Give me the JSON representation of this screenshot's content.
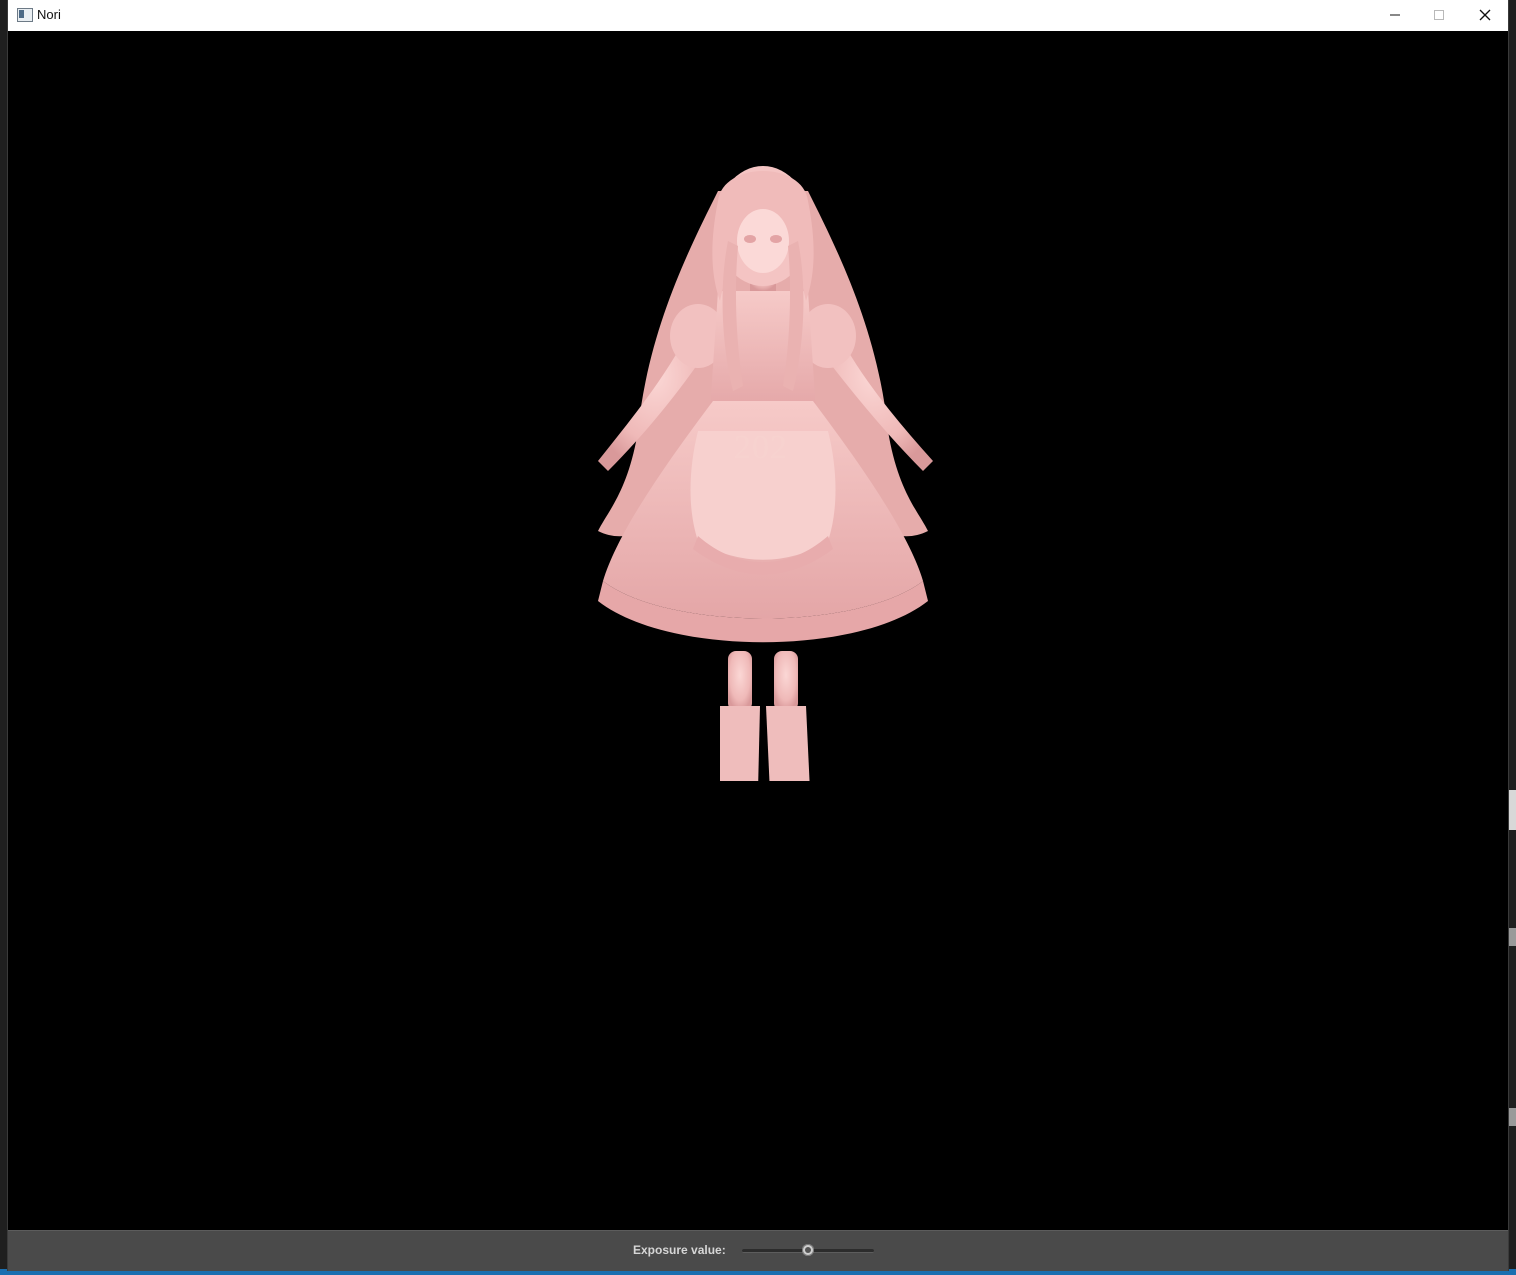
{
  "window": {
    "title": "Nori",
    "controls": {
      "minimize_icon": "minimize-icon",
      "maximize_icon": "maximize-icon",
      "close_icon": "close-icon"
    }
  },
  "render": {
    "apron_text": "202",
    "figure_color": "#f5c8c6",
    "background": "#000000"
  },
  "controls": {
    "exposure_label": "Exposure value:",
    "exposure_fraction": 0.5
  }
}
